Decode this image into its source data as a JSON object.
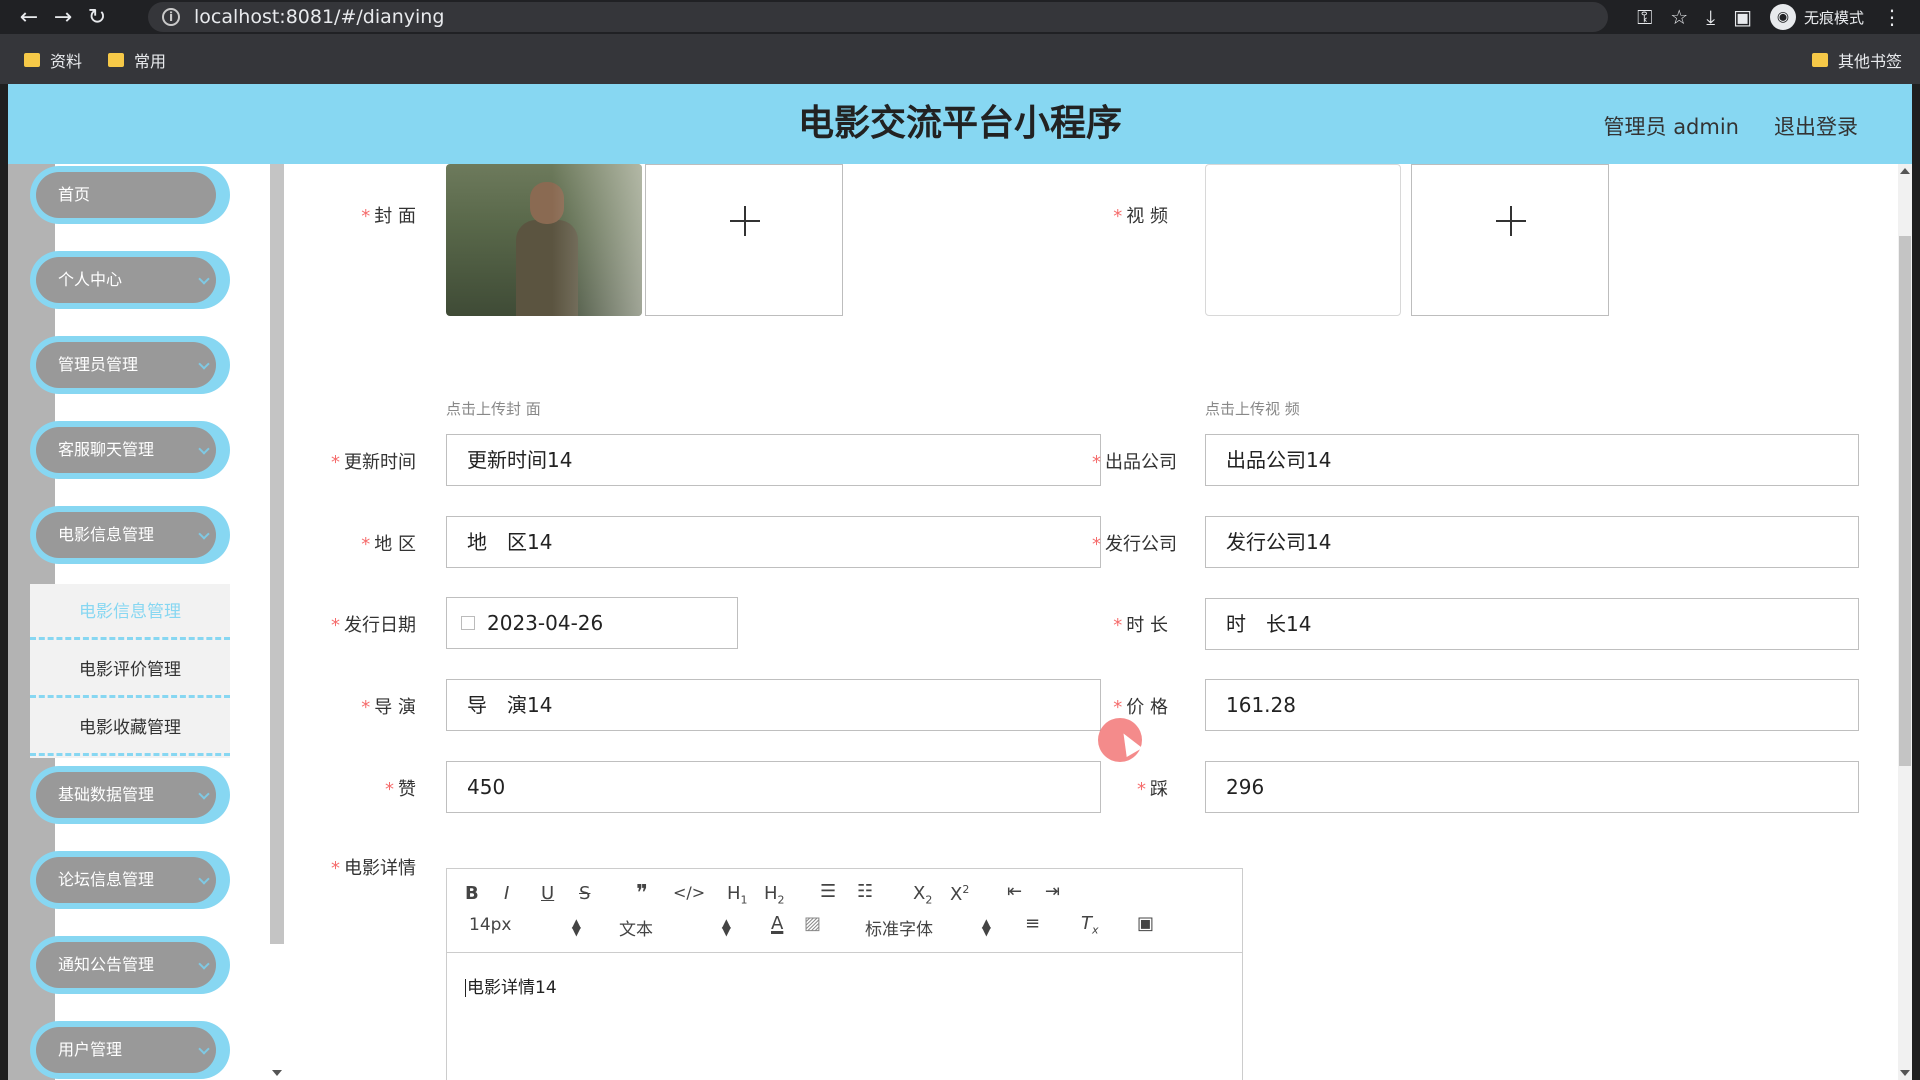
{
  "browser": {
    "url": "localhost:8081/#/dianying",
    "incognito_label": "无痕模式",
    "bookmarks": [
      "资料",
      "常用"
    ],
    "other_bookmarks": "其他书签"
  },
  "header": {
    "title": "电影交流平台小程序",
    "user": "管理员 admin",
    "logout": "退出登录"
  },
  "sidebar": {
    "items": [
      {
        "label": "首页"
      },
      {
        "label": "个人中心"
      },
      {
        "label": "管理员管理"
      },
      {
        "label": "客服聊天管理"
      },
      {
        "label": "电影信息管理"
      },
      {
        "label": "基础数据管理"
      },
      {
        "label": "论坛信息管理"
      },
      {
        "label": "通知公告管理"
      },
      {
        "label": "用户管理"
      }
    ],
    "submenu": [
      {
        "label": "电影信息管理"
      },
      {
        "label": "电影评价管理"
      },
      {
        "label": "电影收藏管理"
      }
    ]
  },
  "form": {
    "cover_label": "封 面",
    "cover_hint": "点击上传封 面",
    "video_label": "视 频",
    "video_hint": "点击上传视 频",
    "update_time": {
      "label": "更新时间",
      "value": "更新时间14"
    },
    "producer": {
      "label": "出品公司",
      "value": "出品公司14"
    },
    "region": {
      "label": "地 区",
      "value": "地　区14"
    },
    "distributor": {
      "label": "发行公司",
      "value": "发行公司14"
    },
    "release_date": {
      "label": "发行日期",
      "value": "2023-04-26"
    },
    "duration": {
      "label": "时 长",
      "value": "时　长14"
    },
    "director": {
      "label": "导 演",
      "value": "导　演14"
    },
    "price": {
      "label": "价 格",
      "value": "161.28"
    },
    "likes": {
      "label": "赞",
      "value": "450"
    },
    "dislikes": {
      "label": "踩",
      "value": "296"
    },
    "details": {
      "label": "电影详情",
      "value": "电影详情14"
    }
  },
  "editor": {
    "font_size": "14px",
    "block_type": "文本",
    "font_family": "标准字体"
  },
  "colors": {
    "accent": "#87d7f2",
    "required": "#f56c6c"
  }
}
